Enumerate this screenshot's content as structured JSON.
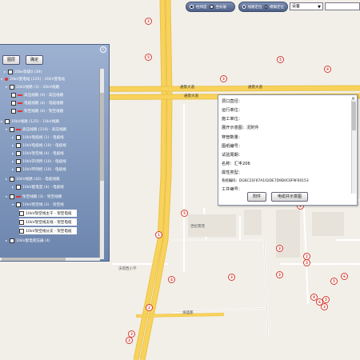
{
  "toolbar": {
    "left_group": {
      "option1": "经纬度",
      "option2": "坐标展"
    },
    "right_group": {
      "option1": "线路定位",
      "option2": "模糊定位"
    },
    "select_value": "设备",
    "search_value": ""
  },
  "tree_panel": {
    "close_glyph": "×",
    "buttons": {
      "locate": "图层",
      "confirm": "确定"
    },
    "items": [
      {
        "text": "20ke等级0 (39)"
      },
      {
        "text": "20kV变电站 (125) - 20kV变电站"
      },
      {
        "text": "20kV线路 (3) - 20kV线路"
      },
      {
        "text": "高压线路 (0) - 高压线路"
      },
      {
        "text": "电缆线路 (4) - 电缆线路"
      },
      {
        "text": "架空线路 (0) - 架空线路"
      },
      {
        "text": "10kV线路 (125) - 10kV线路"
      },
      {
        "text": "高压线路 (110) - 高压线路"
      },
      {
        "text": "10kV电缆线 (1) - 电缆线"
      },
      {
        "text": "10kV电缆线 (10) - 电缆线"
      },
      {
        "text": "10kV架空线 (4) - 电缆线"
      },
      {
        "text": "10kV开闭所 (10) - 电缆线"
      },
      {
        "text": "10kV环网柜 (10) - 电缆线"
      },
      {
        "text": "10kV线路 (42) - 电缆线路"
      },
      {
        "text": "10kV配电室 (4) - 电缆线"
      },
      {
        "text": "架空线路 (3) - 架空线路"
      },
      {
        "text": "10kV架空线 (3) - 架空线"
      },
      {
        "text": "10kV架空线主干 - 架空电缆"
      },
      {
        "text": "10kV架空线支线 - 架空电缆"
      },
      {
        "text": "10kV架空线分支 - 架空电缆"
      },
      {
        "text": "10kV配电变压器 (4)"
      }
    ]
  },
  "popup": {
    "close_glyph": "×",
    "fields": [
      "洞口直径：",
      "运行单位：",
      "施工单位：",
      "展开示意图：况附件",
      "穿管数量：",
      "图纸编号：",
      "试验周期：",
      "名称：汇丰206",
      "属性类型：",
      "系统编码：DG6C21F67A102DE7D9D0C6F9F00153",
      "工井编号："
    ],
    "buttons": {
      "attachment": "附件",
      "diagram": "电缆井示意图"
    }
  },
  "map": {
    "road_labels": [
      "通景大道",
      "通景大道",
      "通景大道"
    ],
    "place_labels": [
      "沃得西小学",
      "世纪景苑",
      "海盛都"
    ],
    "marker_color": "#d43a2f",
    "road_color": "#f8d25a",
    "markers": [
      "2",
      "5",
      "5",
      "8",
      "3",
      "5",
      "1",
      "3",
      "3",
      "2",
      "3",
      "3",
      "3",
      "6",
      "4",
      "5",
      "8",
      "6",
      "5",
      "3",
      "2",
      "3",
      "3"
    ]
  }
}
